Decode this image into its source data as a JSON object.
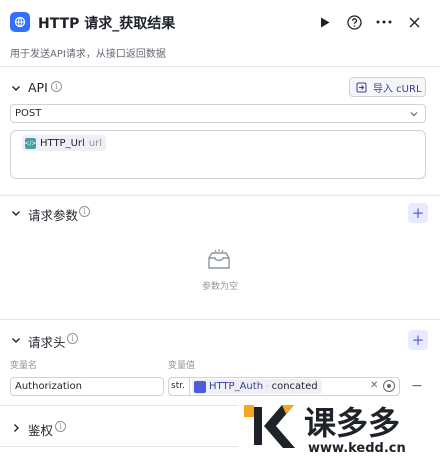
{
  "header": {
    "title": "HTTP 请求_获取结果",
    "description": "用于发送API请求，从接口返回数据",
    "run_icon": "play-icon",
    "help_icon": "help-icon",
    "more_icon": "more-icon",
    "close_icon": "close-icon"
  },
  "api_section": {
    "title": "API",
    "import_label": "导入 cURL",
    "method": "POST",
    "url_variable": {
      "name": "HTTP_Url",
      "type": "url"
    }
  },
  "params_section": {
    "title": "请求参数",
    "empty_text": "参数为空"
  },
  "headers_section": {
    "title": "请求头",
    "col_name_label": "变量名",
    "col_value_label": "变量值",
    "rows": [
      {
        "name": "Authorization",
        "type": "str.",
        "value_source": "HTTP_Auth",
        "value_field": "concated"
      }
    ]
  },
  "auth_section": {
    "title": "鉴权"
  },
  "watermark": {
    "brand": "课多多",
    "url": "www.kedd.cn"
  },
  "colors": {
    "accent": "#3370ff",
    "plus_bg": "#e8ebff",
    "brand_orange": "#f5a623"
  }
}
